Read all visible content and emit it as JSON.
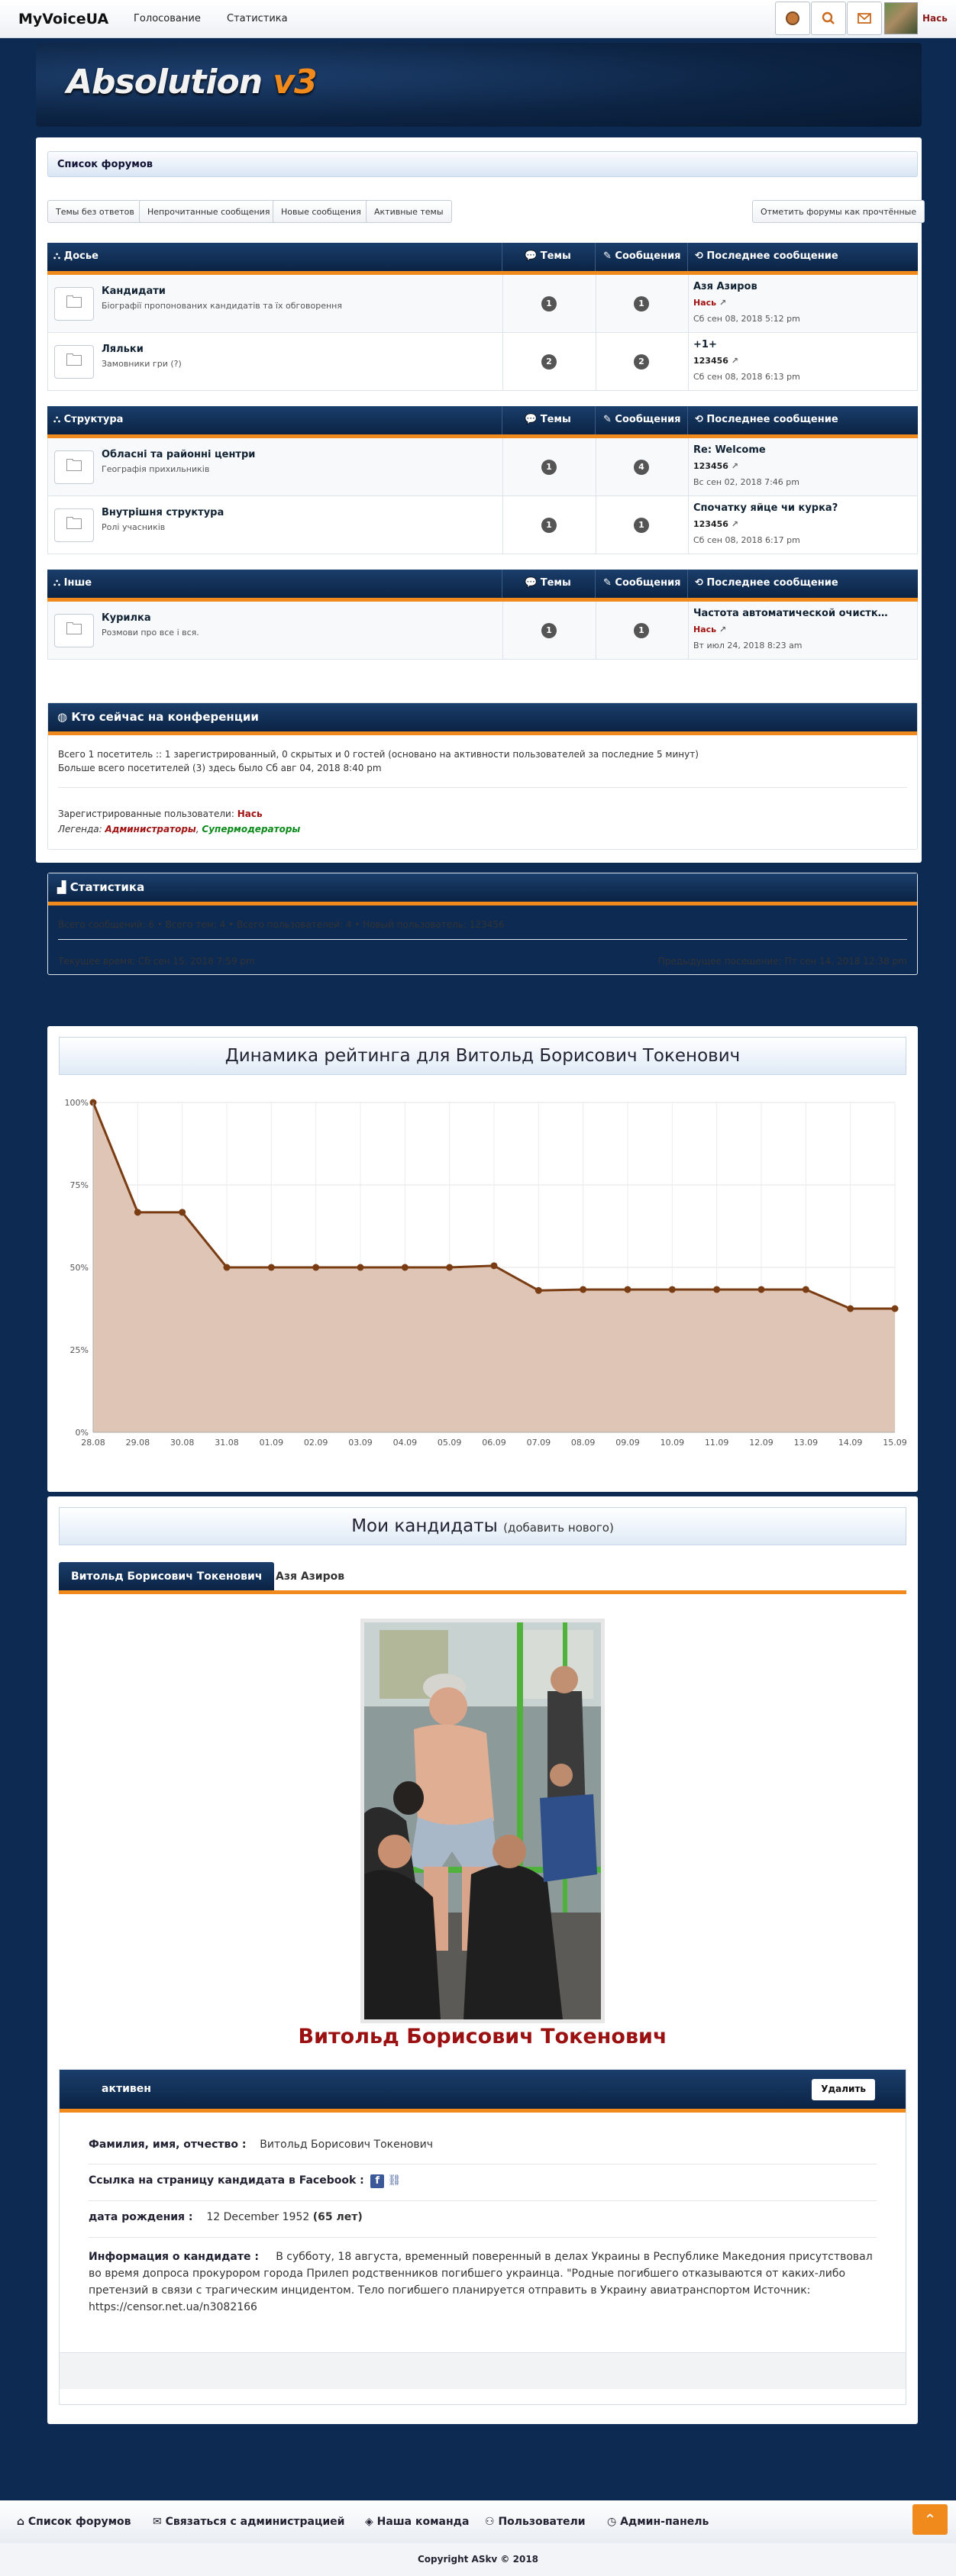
{
  "nav": {
    "brand": "MyVoiceUA",
    "links": [
      "Голосование",
      "Статистика"
    ],
    "user": "Нась"
  },
  "banner": {
    "logo_main": "Absolution",
    "logo_ver": "v3"
  },
  "forum": {
    "title": "Список форумов",
    "quick_links": [
      "Темы без ответов",
      "Непрочитанные сообщения",
      "Новые сообщения",
      "Активные темы"
    ],
    "mark_read": "Отметить форумы как прочтённые",
    "col_topics": "Темы",
    "col_posts": "Сообщения",
    "col_last": "Последнее сообщение",
    "categories": [
      {
        "name": "Досье",
        "forums": [
          {
            "title": "Кандидати",
            "desc": "Біографії пропонованих кандидатів та їх обговорення",
            "topics": "1",
            "posts": "1",
            "last_title": "Азя Азиров",
            "last_user": "Нась",
            "last_user_color": "#a01414",
            "last_date": "Сб сен 08, 2018 5:12 pm"
          },
          {
            "title": "Ляльки",
            "desc": "Замовники гри (?)",
            "topics": "2",
            "posts": "2",
            "last_title": "+1+",
            "last_user": "123456",
            "last_user_color": "#222222",
            "last_date": "Сб сен 08, 2018 6:13 pm"
          }
        ]
      },
      {
        "name": "Структура",
        "forums": [
          {
            "title": "Обласні та районні центри",
            "desc": "Географія прихильників",
            "topics": "1",
            "posts": "4",
            "last_title": "Re: Welcome",
            "last_user": "123456",
            "last_user_color": "#222222",
            "last_date": "Вс сен 02, 2018 7:46 pm"
          },
          {
            "title": "Внутрішня структура",
            "desc": "Ролі учасників",
            "topics": "1",
            "posts": "1",
            "last_title": "Спочатку яйце чи курка?",
            "last_user": "123456",
            "last_user_color": "#222222",
            "last_date": "Сб сен 08, 2018 6:17 pm"
          }
        ]
      },
      {
        "name": "Інше",
        "forums": [
          {
            "title": "Курилка",
            "desc": "Розмови про все і вся.",
            "topics": "1",
            "posts": "1",
            "last_title": "Частота автоматической очистк…",
            "last_user": "Нась",
            "last_user_color": "#a01414",
            "last_date": "Вт июл 24, 2018 8:23 am"
          }
        ]
      }
    ]
  },
  "online": {
    "title": "Кто сейчас на конференции",
    "line1": "Всего 1 посетитель :: 1 зарегистрированный, 0 скрытых и 0 гостей (основано на активности пользователей за последние 5 минут)",
    "line2": "Больше всего посетителей (3) здесь было Сб авг 04, 2018 8:40 pm",
    "registered_label": "Зарегистрированные пользователи:",
    "registered_user": "Нась",
    "legend_label": "Легенда:",
    "legend_admin": "Администраторы",
    "legend_mod": "Супермодераторы"
  },
  "stats": {
    "title": "Статистика",
    "line": "Всего сообщений: 6 • Всего тем: 4 • Всего пользователей: 4 • Новый пользователь: 123456",
    "current_time": "Текущее время: Сб сен 15, 2018 7:59 pm",
    "last_visit": "Предыдущее посещение: Пт сен 14, 2018 12:38 pm"
  },
  "chart_data": {
    "type": "area",
    "title": "Динамика рейтинга для Витольд Борисович Токенович",
    "x": [
      "28.08",
      "29.08",
      "30.08",
      "31.08",
      "01.09",
      "02.09",
      "03.09",
      "04.09",
      "05.09",
      "06.09",
      "07.09",
      "08.09",
      "09.09",
      "10.09",
      "11.09",
      "12.09",
      "13.09",
      "14.09",
      "15.09"
    ],
    "values": [
      100,
      66.7,
      66.7,
      50,
      50,
      50,
      50,
      50,
      50,
      50.5,
      43,
      43.3,
      43.3,
      43.3,
      43.3,
      43.3,
      43.3,
      37.5,
      37.5
    ],
    "yticks": [
      "0%",
      "25%",
      "50%",
      "75%",
      "100%"
    ],
    "ylim": [
      0,
      100
    ],
    "line_color": "#7a3c12",
    "fill_color": "#dfc5b6",
    "grid": true
  },
  "candidates": {
    "title": "Мои кандидаты",
    "add": "(добавить нового)",
    "tabs": [
      "Витольд Борисович Токенович",
      "Азя Азиров"
    ],
    "name": "Витольд Борисович Токенович",
    "status": "активен",
    "delete": "Удалить",
    "fio_label": "Фамилия, имя, отчество :",
    "fio_value": "Витольд Борисович Токенович",
    "fb_label": "Ссылка на страницу кандидата в Facebook :",
    "birth_label": "дата рождения :",
    "birth_value": "12 December 1952",
    "birth_age": "(65 лет)",
    "info_label": "Информация о кандидате :",
    "info_value": "В субботу, 18 августа, временный поверенный в делах Украины в Республике Македония присутствовал во время допроса прокурором города Прилеп родственников погибшего украинца. \"Родные погибшего отказываются от каких-либо претензий в связи с трагическим инцидентом. Тело погибшего планируется отправить в Украину авиатранспортом Источник: https://censor.net.ua/n3082166"
  },
  "footer": {
    "links": [
      "Список форумов",
      "Связаться с администрацией",
      "Наша команда",
      "Пользователи",
      "Админ-панель"
    ],
    "copyright": "Copyright ASkv © 2018"
  }
}
